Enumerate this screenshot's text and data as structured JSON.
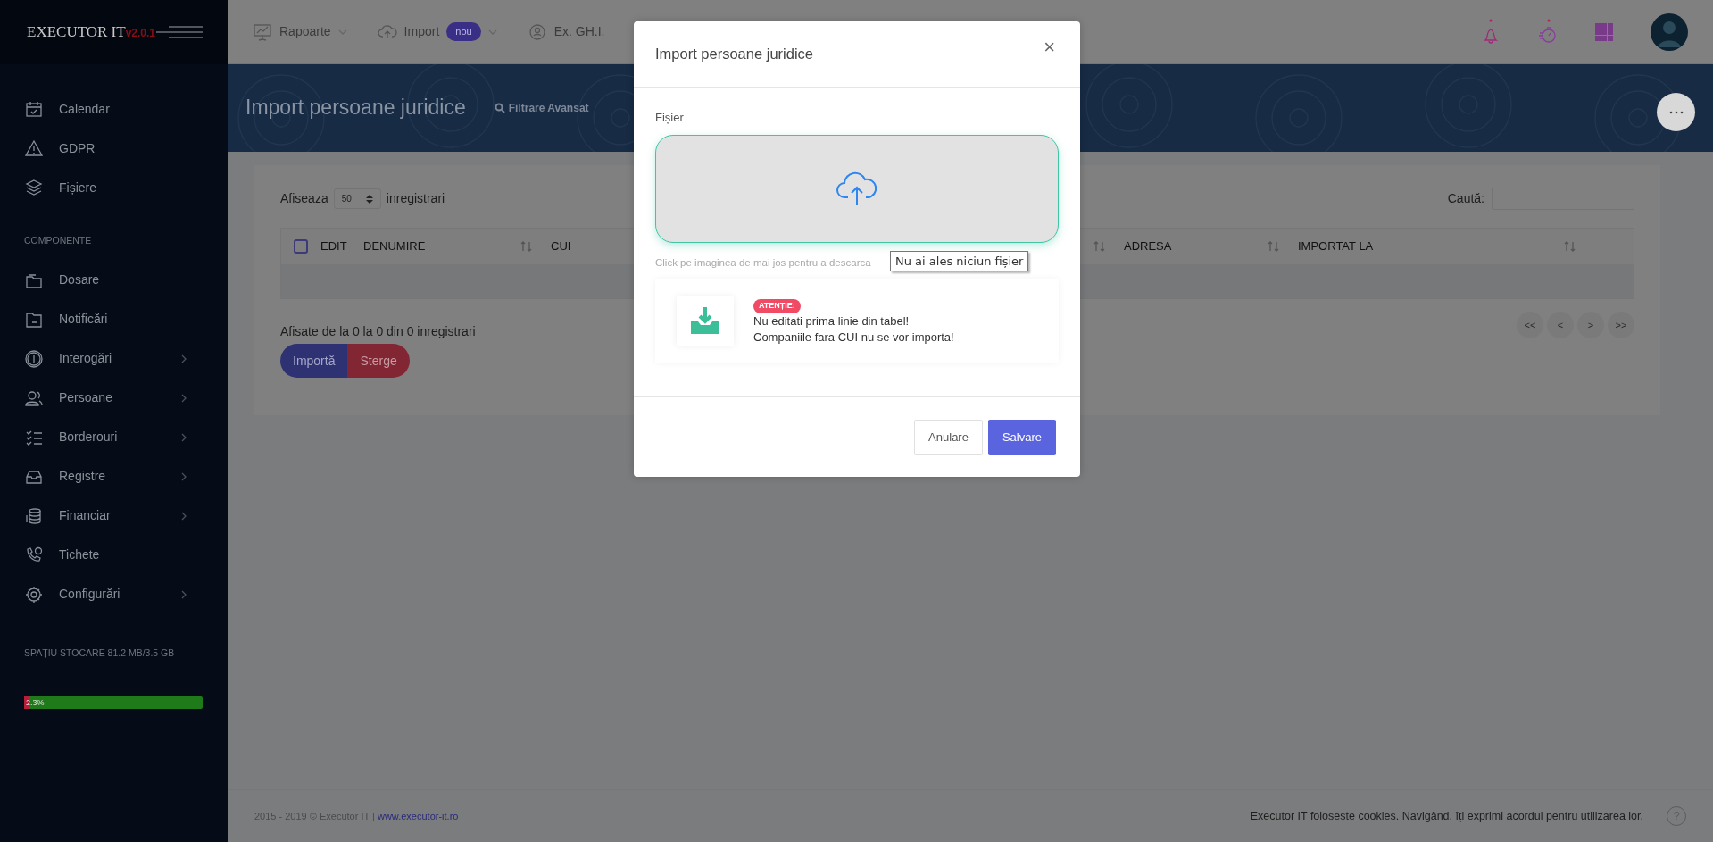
{
  "sidebar": {
    "logo": "EXECUTOR IT",
    "version": "v2.0.1",
    "groups": [
      {
        "items": [
          {
            "label": "Calendar",
            "has_submenu": false
          },
          {
            "label": "GDPR",
            "has_submenu": false
          },
          {
            "label": "Fișiere",
            "has_submenu": false
          }
        ]
      },
      {
        "heading": "COMPONENTE",
        "items": [
          {
            "label": "Dosare",
            "has_submenu": false
          },
          {
            "label": "Notificări",
            "has_submenu": false
          },
          {
            "label": "Interogări",
            "has_submenu": true
          },
          {
            "label": "Persoane",
            "has_submenu": true
          },
          {
            "label": "Borderouri",
            "has_submenu": true
          },
          {
            "label": "Registre",
            "has_submenu": true
          },
          {
            "label": "Financiar",
            "has_submenu": true
          },
          {
            "label": "Tichete",
            "has_submenu": false
          },
          {
            "label": "Configurări",
            "has_submenu": true
          }
        ]
      }
    ],
    "storage": {
      "label": "SPAȚIU STOCARE 81.2 MB/3.5 GB",
      "level": 0.023,
      "reading": "2.3%"
    }
  },
  "topbar": {
    "menus": [
      {
        "label": "Rapoarte",
        "dropdown": true
      },
      {
        "label": "Import",
        "badge": "nou",
        "dropdown": true
      },
      {
        "label": "Ex. GH.I.",
        "dropdown": false
      }
    ]
  },
  "banner": {
    "title": "Import persoane juridice",
    "filter_link": "Filtrare Avansat"
  },
  "table_panel": {
    "show_label": "Afiseaza",
    "page_size": "50",
    "show_suffix": "inregistrari",
    "search_label": "Caută:",
    "select_all_checked": false,
    "columns": [
      {
        "label": "EDIT",
        "sortable": false
      },
      {
        "label": "DENUMIRE",
        "sortable": true
      },
      {
        "label": "CUI",
        "sortable": true
      },
      {
        "label": "ADRESA",
        "sortable": true
      },
      {
        "label": "IMPORTAT LA",
        "sortable": true
      }
    ],
    "info": "Afisate de la 0 la 0 din 0 inregistrari",
    "actions": [
      "Importă",
      "Sterge"
    ],
    "pager": [
      "<<",
      "<",
      ">",
      ">>"
    ]
  },
  "footer": {
    "copyright": "2015 - 2019 © Executor IT | ",
    "link": "www.executor-it.ro",
    "cookies": "Executor IT folosește cookies. Navigând, îți exprimi acordul pentru utilizarea lor.",
    "help": "?"
  },
  "modal": {
    "title": "Import persoane juridice",
    "close": "×",
    "field_label": "Fișier",
    "hint": "Click pe imaginea de mai jos pentru a descarca",
    "tooltip": "Nu ai ales niciun fișier",
    "notice": {
      "badge": "ATENȚIE:",
      "lines": [
        "Nu editati prima linie din tabel!",
        "Companiile fara CUI nu se vor importa!"
      ]
    },
    "buttons": [
      {
        "label": "Anulare",
        "kind": "secondary"
      },
      {
        "label": "Salvare",
        "kind": "primary"
      }
    ]
  }
}
